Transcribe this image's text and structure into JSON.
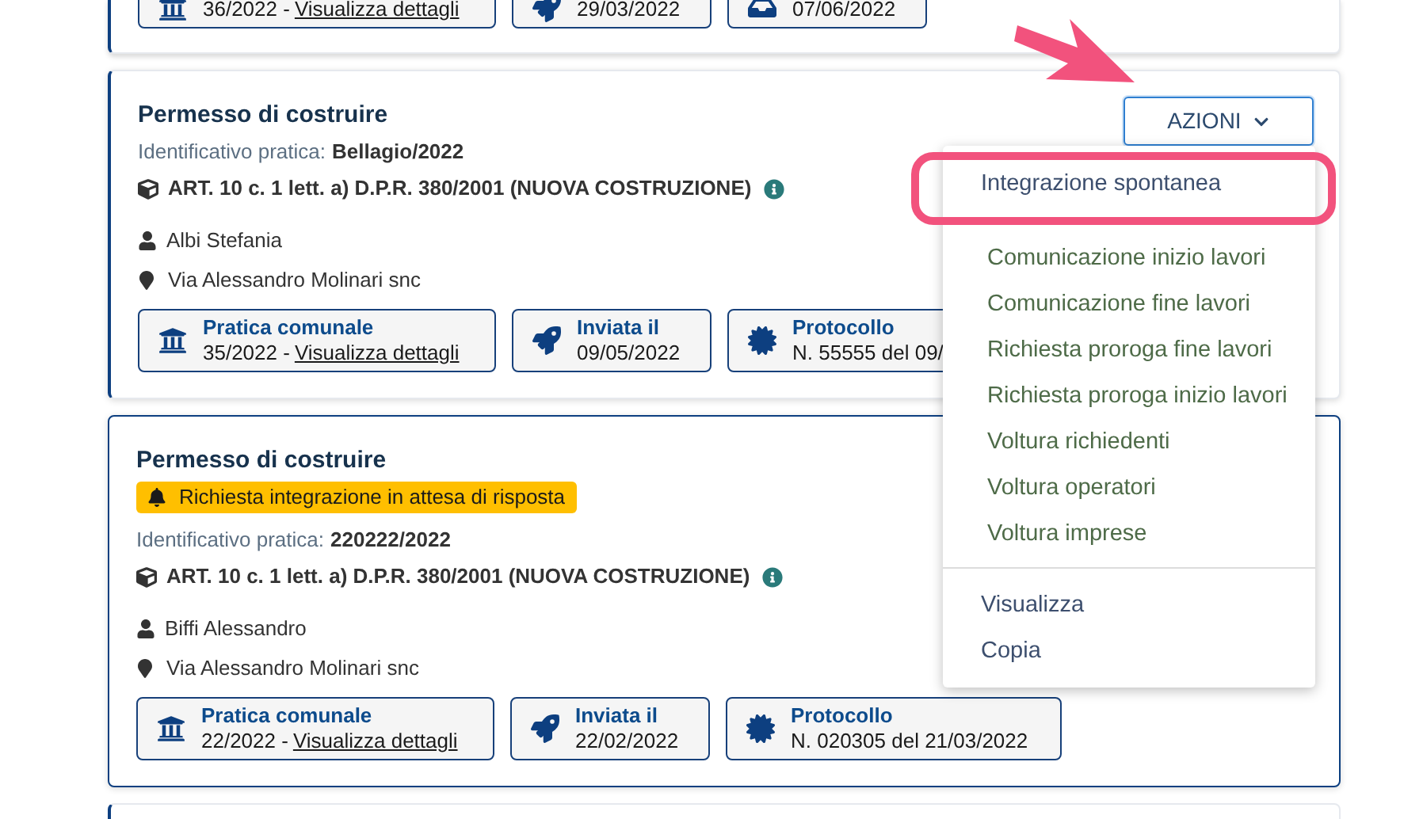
{
  "cards": [
    {
      "kind": "partial",
      "selected": false,
      "chips": [
        {
          "kind": "municipal",
          "value": "36/2022 - ",
          "link": "Visualizza dettagli"
        },
        {
          "kind": "sent",
          "value": "29/03/2022"
        },
        {
          "kind": "received",
          "value": "07/06/2022"
        }
      ]
    },
    {
      "kind": "full",
      "selected": false,
      "title": "Permesso di costruire",
      "id_label": "Identificativo pratica:",
      "id_value": "Bellagio/2022",
      "category": "ART. 10 c. 1 lett. a) D.P.R. 380/2001 (NUOVA COSTRUZIONE)",
      "applicant": "Albi Stefania",
      "address": "Via Alessandro Molinari snc",
      "actions": {
        "label": "AZIONI",
        "expanded": true
      },
      "chips": [
        {
          "kind": "municipal",
          "title": "Pratica comunale",
          "value": "35/2022 - ",
          "link": "Visualizza dettagli"
        },
        {
          "kind": "sent",
          "title": "Inviata il",
          "value": "09/05/2022"
        },
        {
          "kind": "protocol",
          "title": "Protocollo",
          "value": "N. 55555 del 09/"
        }
      ]
    },
    {
      "kind": "full",
      "selected": true,
      "title": "Permesso di costruire",
      "badge": "Richiesta integrazione in attesa di risposta",
      "id_label": "Identificativo pratica:",
      "id_value": "220222/2022",
      "category": "ART. 10 c. 1 lett. a) D.P.R. 380/2001 (NUOVA COSTRUZIONE)",
      "applicant": "Biffi Alessandro",
      "address": "Via Alessandro Molinari snc",
      "chips": [
        {
          "kind": "municipal",
          "title": "Pratica comunale",
          "value": "22/2022 - ",
          "link": "Visualizza dettagli"
        },
        {
          "kind": "sent",
          "title": "Inviata il",
          "value": "22/02/2022"
        },
        {
          "kind": "protocol",
          "title": "Protocollo",
          "value": "N. 020305 del 21/03/2022"
        }
      ]
    },
    {
      "kind": "edge",
      "selected": false
    }
  ],
  "menu": {
    "sections": [
      {
        "kind": "highlighted",
        "items": [
          "Integrazione spontanea"
        ]
      },
      {
        "kind": "green",
        "items": [
          "Comunicazione inizio lavori",
          "Comunicazione fine lavori",
          "Richiesta proroga fine lavori",
          "Richiesta proroga inizio lavori",
          "Voltura richiedenti",
          "Voltura operatori",
          "Voltura imprese"
        ]
      },
      {
        "kind": "plain",
        "items": [
          "Visualizza",
          "Copia"
        ]
      }
    ]
  }
}
